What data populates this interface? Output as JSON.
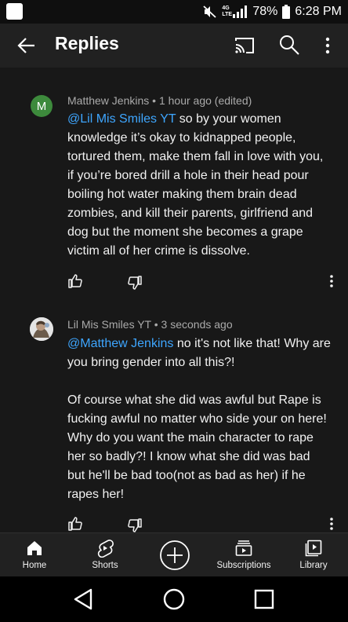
{
  "status_bar": {
    "network": "4G LTE",
    "battery": "78%",
    "time": "6:28 PM"
  },
  "header": {
    "title": "Replies",
    "icons": [
      "back-arrow-icon",
      "cast-icon",
      "search-icon",
      "more-vert-icon"
    ]
  },
  "replies": [
    {
      "avatar_letter": "M",
      "avatar_color": "#3d8a3c",
      "author": "Matthew Jenkins",
      "time": "1 hour ago (edited)",
      "mention": "@Lil Mis Smiles YT",
      "text": "so by your women knowledge it’s okay to kidnapped people, tortured them, make them fall in love with you, if you’re bored drill a hole in their head pour boiling hot water making them brain dead zombies, and kill their parents, girlfriend and dog but the moment she becomes a grape victim all of her crime is dissolve."
    },
    {
      "author": "Lil Mis Smiles YT",
      "time": "3 seconds ago",
      "mention": "@Matthew Jenkins",
      "text": "no it's not like that! Why are you bring gender into all this?!",
      "text2": "Of course what she did was awful but Rape is fucking awful no matter who side your on here! Why do you want the main character to rape her so badly?! I know what she did was bad but he'll be bad too(not as bad as her)  if he rapes her!"
    }
  ],
  "separator": "•",
  "bottom_nav": {
    "home": "Home",
    "shorts": "Shorts",
    "subscriptions": "Subscriptions",
    "library": "Library"
  },
  "colors": {
    "background": "#181818",
    "bar": "#212121",
    "mention": "#3ea6ff",
    "meta": "#aaaaaa"
  }
}
